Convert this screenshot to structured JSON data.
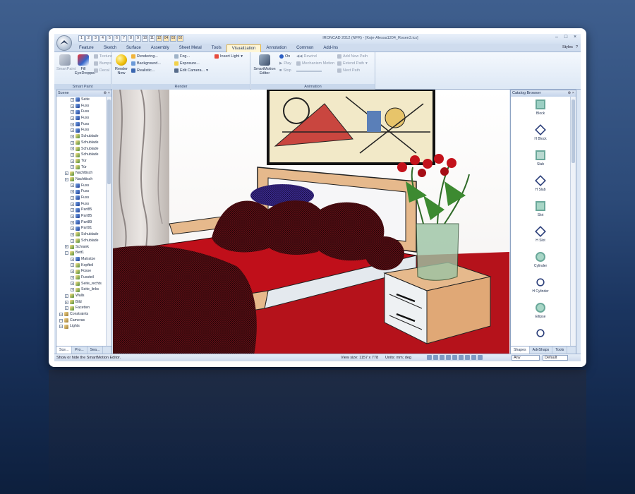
{
  "window": {
    "title": "IRONCAD 2012 (NFR) - [Koje-Alessa1204_Rosen3.ics]",
    "quick_access": [
      "1",
      "2",
      "3",
      "4",
      "5",
      "6",
      "7",
      "8",
      "9",
      "10",
      "11",
      "12",
      "04",
      "03",
      "02"
    ]
  },
  "tabs": [
    {
      "label": "Feature",
      "active": false
    },
    {
      "label": "Sketch",
      "active": false
    },
    {
      "label": "Surface",
      "active": false
    },
    {
      "label": "Assembly",
      "active": false
    },
    {
      "label": "Sheet Metal",
      "active": false
    },
    {
      "label": "Tools",
      "active": false
    },
    {
      "label": "Visualization",
      "active": true
    },
    {
      "label": "Annotation",
      "active": false
    },
    {
      "label": "Common",
      "active": false
    },
    {
      "label": "Add-Ins",
      "active": false
    }
  ],
  "styles_menu": {
    "label": "Styles",
    "help": "?"
  },
  "ribbon": {
    "smart_paint": {
      "title": "Smart Paint",
      "smartpaint": "SmartPaint",
      "fill": "Fill",
      "eyedropper": "EyeDropper",
      "texture": "Texture",
      "bumps": "Bumps",
      "decal": "Decal"
    },
    "render": {
      "title": "Render",
      "render_now_1": "Render",
      "render_now_2": "Now",
      "rendering": "Rendering...",
      "background": "Background...",
      "realistic": "Realistic...",
      "fog": "Fog...",
      "exposure": "Exposure...",
      "edit_camera": "Edit Camera...",
      "insert_light": "Insert Light"
    },
    "animation": {
      "title": "Animation",
      "smartmotion_1": "SmartMotion",
      "smartmotion_2": "Editor",
      "on": "On",
      "play": "Play",
      "stop": "Stop",
      "rewind": "Rewind",
      "mechanism_motion": "Mechanism Motion",
      "add_new_path": "Add New Path",
      "extend_path": "Extend Path",
      "next_path": "Next Path"
    }
  },
  "scene_panel": {
    "title": "Scene",
    "items": [
      {
        "label": "Seite",
        "indent": 2,
        "type": "part"
      },
      {
        "label": "Fuss",
        "indent": 2,
        "type": "part"
      },
      {
        "label": "Fuss",
        "indent": 2,
        "type": "part"
      },
      {
        "label": "Fuss",
        "indent": 2,
        "type": "part"
      },
      {
        "label": "Fuss",
        "indent": 2,
        "type": "part"
      },
      {
        "label": "Fuss",
        "indent": 2,
        "type": "part"
      },
      {
        "label": "Schublade",
        "indent": 2,
        "type": "asm"
      },
      {
        "label": "Schublade",
        "indent": 2,
        "type": "asm"
      },
      {
        "label": "Schublade",
        "indent": 2,
        "type": "asm"
      },
      {
        "label": "Schublade",
        "indent": 2,
        "type": "asm"
      },
      {
        "label": "Tür",
        "indent": 2,
        "type": "asm"
      },
      {
        "label": "Tür",
        "indent": 2,
        "type": "asm"
      },
      {
        "label": "Nachttisch",
        "indent": 1,
        "type": "asm"
      },
      {
        "label": "Nachttisch",
        "indent": 1,
        "type": "asm"
      },
      {
        "label": "Fuss",
        "indent": 2,
        "type": "part"
      },
      {
        "label": "Fuss",
        "indent": 2,
        "type": "part"
      },
      {
        "label": "Fuss",
        "indent": 2,
        "type": "part"
      },
      {
        "label": "Fuss",
        "indent": 2,
        "type": "part"
      },
      {
        "label": "Part85",
        "indent": 2,
        "type": "part"
      },
      {
        "label": "Part85",
        "indent": 2,
        "type": "part"
      },
      {
        "label": "Part89",
        "indent": 2,
        "type": "part"
      },
      {
        "label": "Part91",
        "indent": 2,
        "type": "part"
      },
      {
        "label": "Schublade",
        "indent": 2,
        "type": "asm"
      },
      {
        "label": "Schublade",
        "indent": 2,
        "type": "asm"
      },
      {
        "label": "Schrank",
        "indent": 1,
        "type": "asm"
      },
      {
        "label": "Bett1",
        "indent": 1,
        "type": "asm"
      },
      {
        "label": "Matratze",
        "indent": 2,
        "type": "part"
      },
      {
        "label": "Kopfteil",
        "indent": 2,
        "type": "asm"
      },
      {
        "label": "Füsse",
        "indent": 2,
        "type": "asm"
      },
      {
        "label": "Fussteil",
        "indent": 2,
        "type": "asm"
      },
      {
        "label": "Seite_rechts",
        "indent": 2,
        "type": "asm"
      },
      {
        "label": "Seite_links",
        "indent": 2,
        "type": "asm"
      },
      {
        "label": "Walls",
        "indent": 1,
        "type": "asm"
      },
      {
        "label": "Bild",
        "indent": 1,
        "type": "asm"
      },
      {
        "label": "Facetten",
        "indent": 1,
        "type": "asm"
      },
      {
        "label": "Constraints",
        "indent": 0,
        "type": "root"
      },
      {
        "label": "Cameras",
        "indent": 0,
        "type": "root"
      },
      {
        "label": "Lights",
        "indent": 0,
        "type": "root"
      }
    ],
    "tabs": [
      "Sce...",
      "Pro...",
      "Sea..."
    ]
  },
  "catalog_panel": {
    "title": "Catalog Browser",
    "items": [
      "Block",
      "H Block",
      "Slab",
      "H Slab",
      "Slot",
      "H Slot",
      "Cylinder",
      "H Cylinder",
      "Ellipse",
      ""
    ],
    "tabs": [
      "Shapes",
      "AdvShaps",
      "Tools"
    ]
  },
  "status": {
    "hint": "Show or hide the SmartMotion Editor.",
    "view_size": "View size: 1157 x 778",
    "units": "Units: mm; deg",
    "filter": "Any",
    "style": "Default"
  },
  "colors": {
    "accent_tab": "#fef6d6",
    "window_frame": "#dbe6f4",
    "scene_red": "#b5121b",
    "wood": "#e6b98c"
  }
}
